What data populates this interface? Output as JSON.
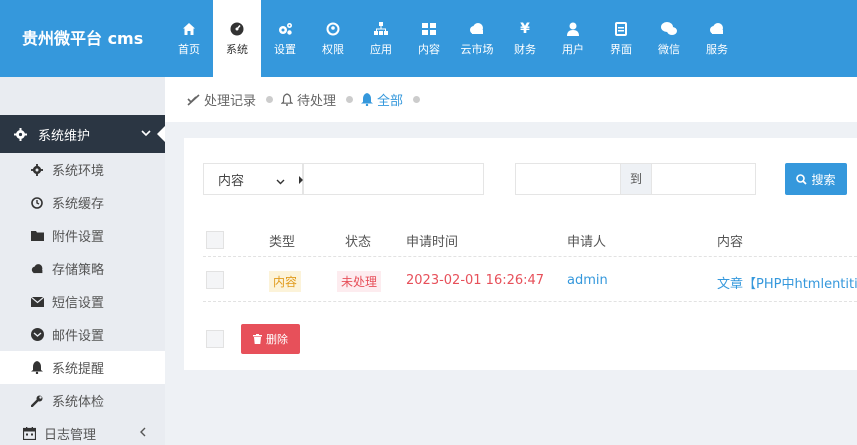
{
  "brand": "贵州微平台 cms",
  "nav": [
    {
      "label": "首页",
      "icon": "home-icon"
    },
    {
      "label": "系统",
      "icon": "dashboard-icon",
      "active": true
    },
    {
      "label": "设置",
      "icon": "cogs-icon"
    },
    {
      "label": "权限",
      "icon": "user-circle-icon"
    },
    {
      "label": "应用",
      "icon": "sitemap-icon"
    },
    {
      "label": "内容",
      "icon": "grid-icon"
    },
    {
      "label": "云市场",
      "icon": "cloud-icon"
    },
    {
      "label": "财务",
      "icon": "yen-icon"
    },
    {
      "label": "用户",
      "icon": "user-icon"
    },
    {
      "label": "界面",
      "icon": "window-icon"
    },
    {
      "label": "微信",
      "icon": "wechat-icon"
    },
    {
      "label": "服务",
      "icon": "cloud-icon"
    }
  ],
  "sidebar": {
    "section": "系统维护",
    "items": [
      {
        "label": "系统环境",
        "icon": "gear-icon"
      },
      {
        "label": "系统缓存",
        "icon": "clock-icon"
      },
      {
        "label": "附件设置",
        "icon": "folder-icon"
      },
      {
        "label": "存储策略",
        "icon": "cloud-icon"
      },
      {
        "label": "短信设置",
        "icon": "envelope-icon"
      },
      {
        "label": "邮件设置",
        "icon": "envelope-open-icon"
      },
      {
        "label": "系统提醒",
        "icon": "bell-icon",
        "active": true
      },
      {
        "label": "系统体检",
        "icon": "wrench-icon"
      }
    ],
    "log": "日志管理"
  },
  "tabs": [
    {
      "label": "处理记录",
      "icon": "check-slash-icon"
    },
    {
      "label": "待处理",
      "icon": "bell-outline-icon"
    },
    {
      "label": "全部",
      "icon": "bell-icon",
      "active": true
    }
  ],
  "search": {
    "field": "内容",
    "to_label": "到",
    "button": "搜索"
  },
  "table": {
    "headers": [
      "类型",
      "状态",
      "申请时间",
      "申请人",
      "内容"
    ],
    "rows": [
      {
        "type": "内容",
        "status": "未处理",
        "time": "2023-02-01 16:26:47",
        "user": "admin",
        "content": "文章【PHP中htmlentitie"
      }
    ]
  },
  "delete_button": "删除",
  "colors": {
    "primary": "#3598dc",
    "sidebar_dark": "#2b3643",
    "danger": "#e7505a",
    "warning": "#e09b1d"
  }
}
